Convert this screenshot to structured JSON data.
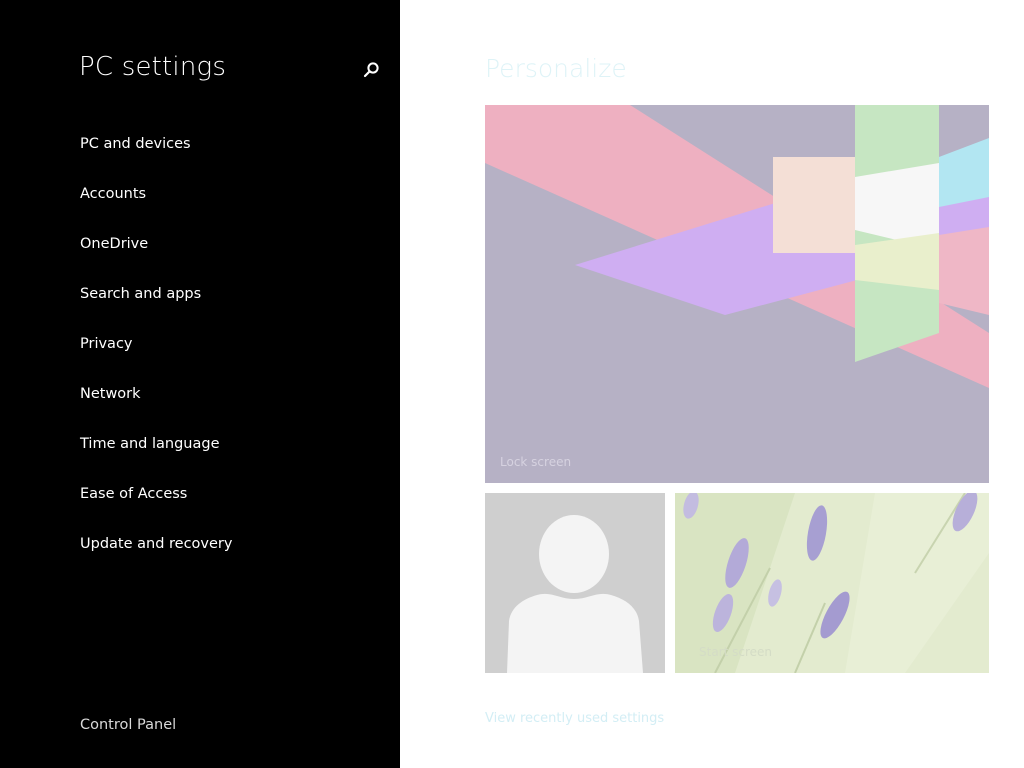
{
  "sidebar": {
    "title": "PC settings",
    "search_icon": "search-icon",
    "items": [
      {
        "label": "PC and devices"
      },
      {
        "label": "Accounts"
      },
      {
        "label": "OneDrive"
      },
      {
        "label": "Search and apps"
      },
      {
        "label": "Privacy"
      },
      {
        "label": "Network"
      },
      {
        "label": "Time and language"
      },
      {
        "label": "Ease of Access"
      },
      {
        "label": "Update and recovery"
      }
    ],
    "control_panel": "Control Panel"
  },
  "main": {
    "title": "Personalize",
    "tiles": {
      "lock_screen": {
        "caption": "Lock screen"
      },
      "account_picture": {
        "icon": "user-silhouette-icon"
      },
      "start_screen": {
        "caption": "Start screen"
      }
    },
    "recent_link": "View recently used settings"
  },
  "colors": {
    "sidebar_background": "#000000",
    "main_background": "#ffffff",
    "title_text": "#def3f7",
    "lock_tile_background": "#b6b1c5",
    "account_tile_background": "#cfcfcf"
  }
}
